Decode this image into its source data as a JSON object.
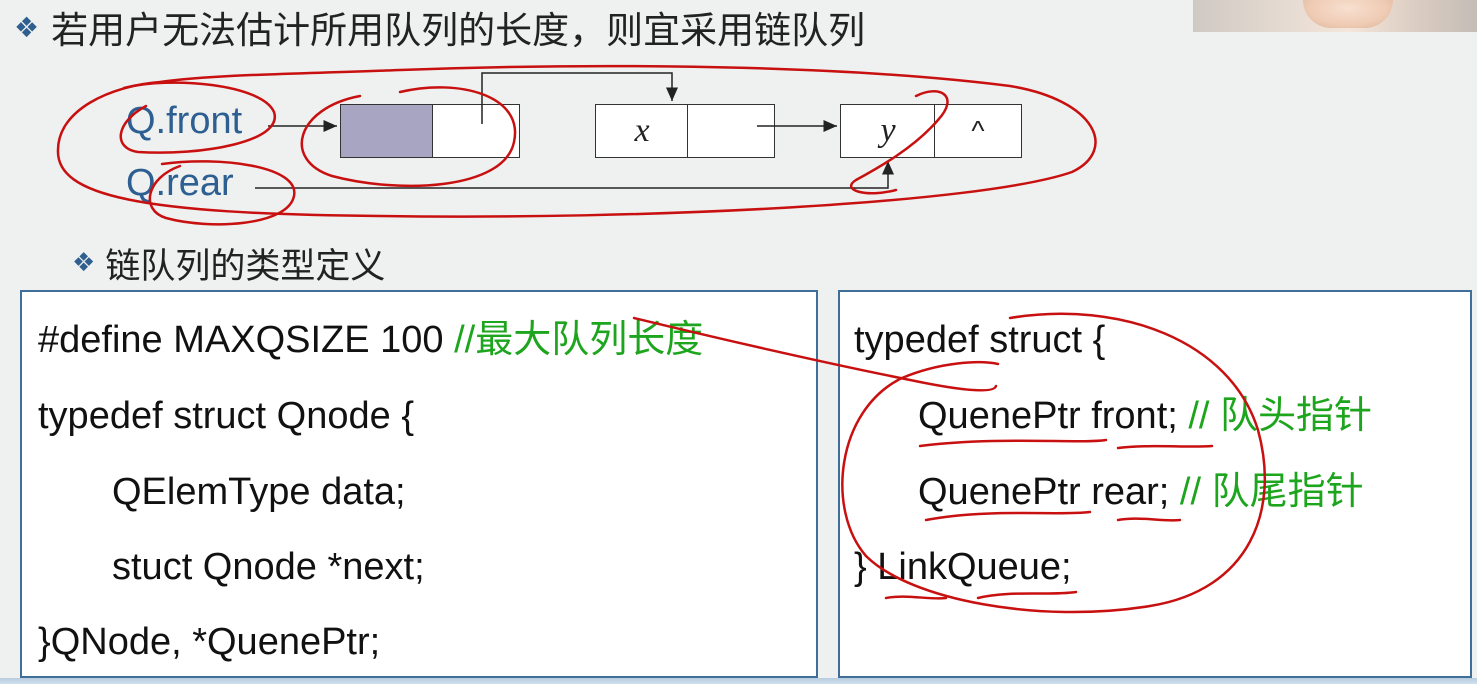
{
  "heading": {
    "bullet": "❖",
    "text": "若用户无法估计所用队列的长度，则宜采用链队列"
  },
  "diagram": {
    "front_label": "Q.front",
    "rear_label": "Q.rear",
    "nodes": [
      {
        "data": "",
        "next": ""
      },
      {
        "data": "x",
        "next": ""
      },
      {
        "data": "y",
        "next": "^"
      }
    ]
  },
  "subheading": {
    "bullet": "❖",
    "text": "链队列的类型定义"
  },
  "left_code": {
    "lines": [
      {
        "code": "#define MAXQSIZE 100 ",
        "comment": "//最大队列长度"
      },
      {
        "code": "typedef struct  Qnode {",
        "comment": ""
      },
      {
        "code": "QElemType    data;",
        "comment": ""
      },
      {
        "code": "stuct  Qnode  *next;",
        "comment": ""
      },
      {
        "code": "}QNode, *QuenePtr;",
        "comment": ""
      }
    ]
  },
  "right_code": {
    "lines": [
      {
        "code": "typedef struct {",
        "comment": ""
      },
      {
        "code": "QuenePtr front; ",
        "comment": "// 队头指针"
      },
      {
        "code": "QuenePtr rear; ",
        "comment": "// 队尾指针"
      },
      {
        "code": "} LinkQueue;",
        "comment": ""
      }
    ]
  },
  "colors": {
    "label_blue": "#2e5f92",
    "comment_green": "#1ea51e",
    "annotation_red": "#c81010",
    "head_node_fill": "#a7a5c2",
    "box_border": "#3f6e98"
  }
}
